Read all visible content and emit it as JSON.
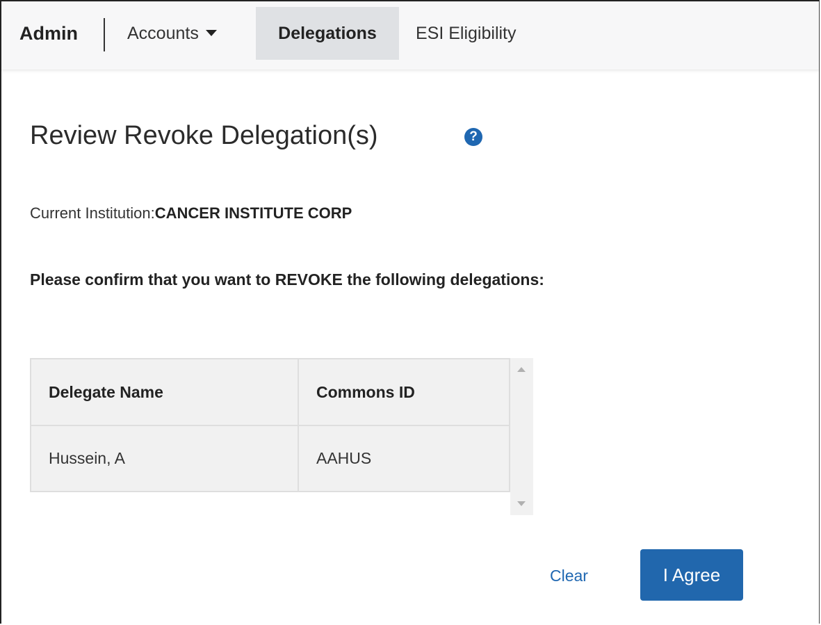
{
  "navbar": {
    "brand": "Admin",
    "items": [
      {
        "label": "Accounts",
        "has_dropdown": true,
        "active": false
      },
      {
        "label": "Delegations",
        "active": true
      },
      {
        "label": "ESI Eligibility",
        "active": false
      }
    ]
  },
  "page": {
    "title": "Review Revoke Delegation(s)",
    "help_icon": "question-circle-icon",
    "institution_label": "Current Institution:",
    "institution_name": "CANCER INSTITUTE CORP",
    "confirm_text": "Please confirm that you want to REVOKE the following delegations:"
  },
  "table": {
    "columns": [
      "Delegate Name",
      "Commons ID"
    ],
    "rows": [
      {
        "name": "Hussein, A",
        "commons_id": "AAHUS"
      }
    ]
  },
  "actions": {
    "clear_label": "Clear",
    "agree_label": "I Agree"
  },
  "colors": {
    "primary": "#2167ad",
    "link": "#1f67b1",
    "active_tab_bg": "#dfe1e4",
    "navbar_bg": "#f7f7f8",
    "table_bg": "#f1f1f1"
  }
}
